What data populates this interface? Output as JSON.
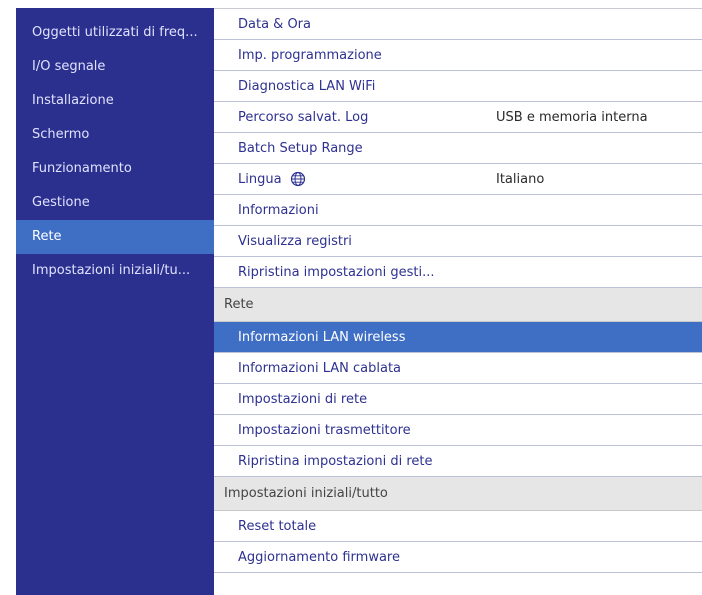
{
  "sidebar": {
    "items": [
      {
        "label": "Oggetti utilizzati di freq..."
      },
      {
        "label": "I/O segnale"
      },
      {
        "label": "Installazione"
      },
      {
        "label": "Schermo"
      },
      {
        "label": "Funzionamento"
      },
      {
        "label": "Gestione"
      },
      {
        "label": "Rete"
      },
      {
        "label": "Impostazioni iniziali/tu..."
      }
    ],
    "selected": "Rete"
  },
  "content": {
    "gestione_items": [
      {
        "label": "Data & Ora",
        "value": ""
      },
      {
        "label": "Imp. programmazione",
        "value": ""
      },
      {
        "label": "Diagnostica LAN WiFi",
        "value": ""
      },
      {
        "label": "Percorso salvat. Log",
        "value": "USB e memoria interna"
      },
      {
        "label": "Batch Setup Range",
        "value": ""
      },
      {
        "label": "Lingua",
        "value": "Italiano",
        "icon": "globe-icon"
      },
      {
        "label": "Informazioni",
        "value": ""
      },
      {
        "label": "Visualizza registri",
        "value": ""
      },
      {
        "label": "Ripristina impostazioni gesti...",
        "value": ""
      }
    ],
    "rete_section": {
      "title": "Rete",
      "items": [
        {
          "label": "Informazioni LAN wireless"
        },
        {
          "label": "Informazioni LAN cablata"
        },
        {
          "label": "Impostazioni di rete"
        },
        {
          "label": "Impostazioni trasmettitore"
        },
        {
          "label": "Ripristina impostazioni di rete"
        }
      ]
    },
    "iniziali_section": {
      "title": "Impostazioni iniziali/tutto",
      "items": [
        {
          "label": "Reset totale"
        },
        {
          "label": "Aggiornamento firmware"
        }
      ]
    }
  },
  "colors": {
    "sidebar_bg": "#2b2f8d",
    "highlight": "#3f6fc4",
    "item_text": "#2e3191",
    "section_bg": "#e6e6e6"
  }
}
